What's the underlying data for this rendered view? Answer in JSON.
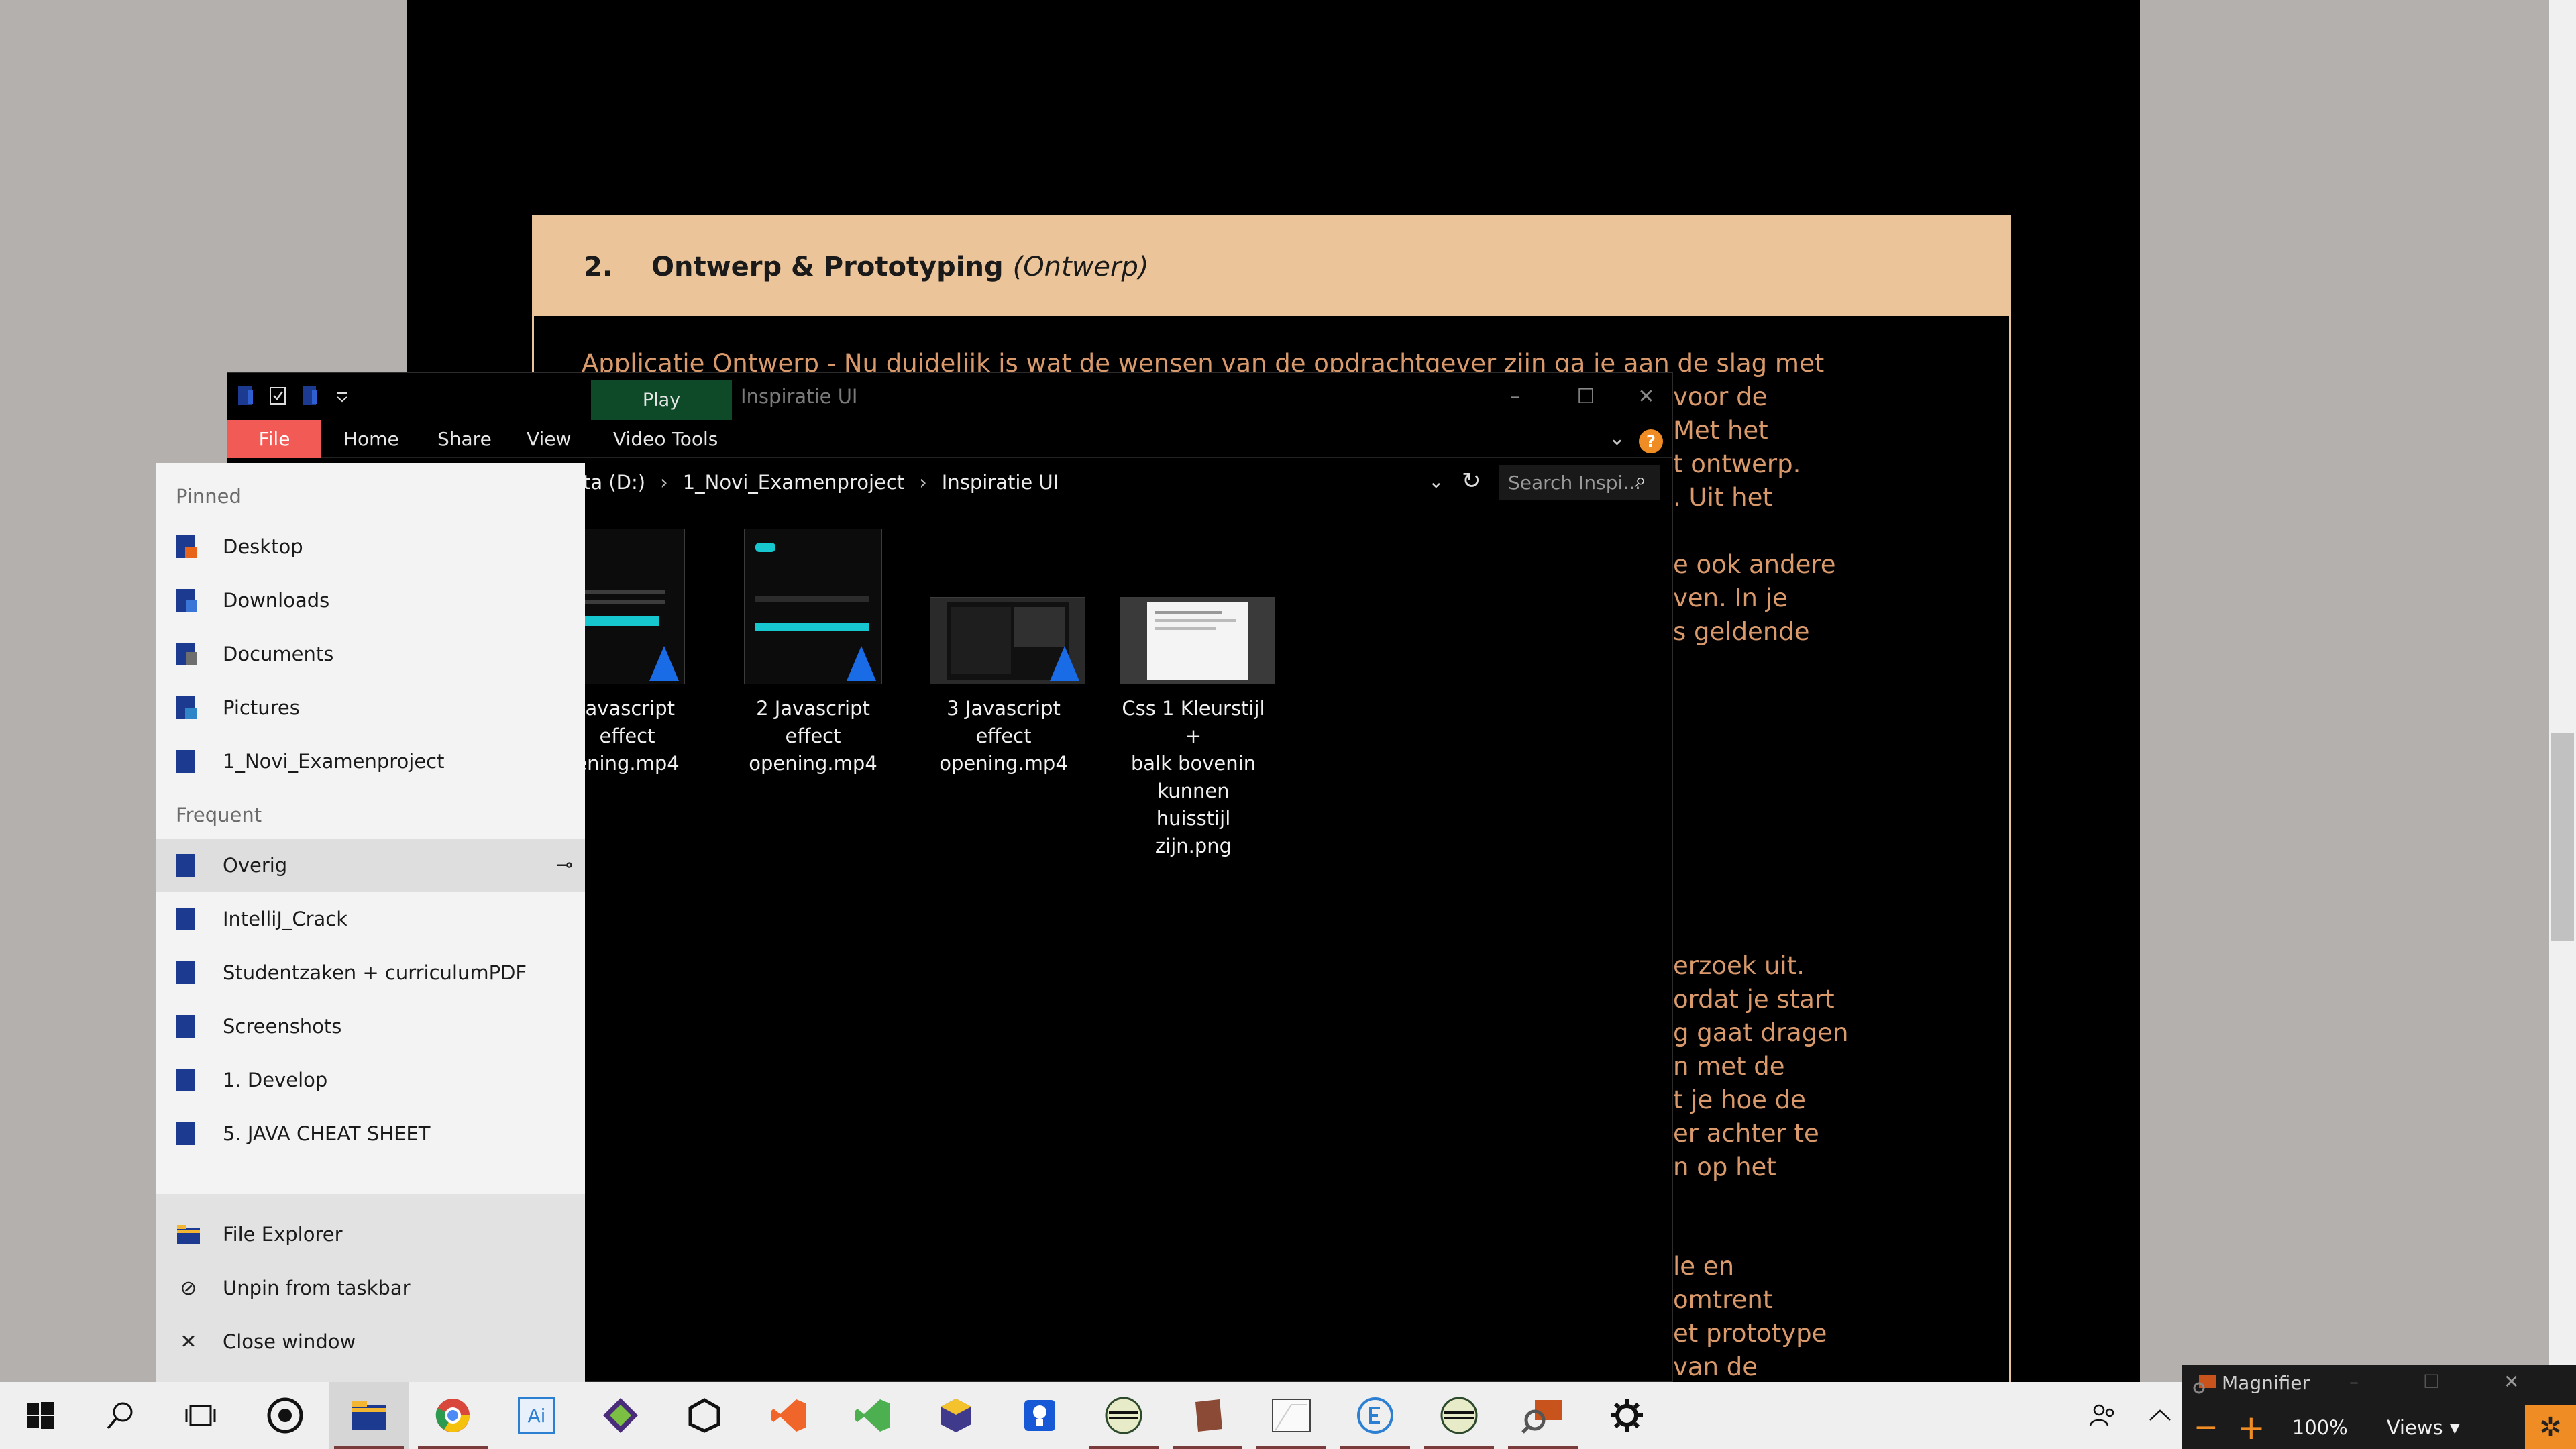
{
  "document": {
    "section_number": "2.",
    "section_title": "Ontwerp & Prototyping",
    "section_subtitle": "(Ontwerp)",
    "lines_top": [
      "Applicatie Ontwerp - Nu duidelijk is wat de wensen van de opdrachtgever zijn ga je aan de slag met",
      "voor de",
      "Met het",
      "t ontwerp.",
      ". Uit het"
    ],
    "lines_mid": [
      "e ook andere",
      "ven. In je",
      "s geldende"
    ],
    "lines_low": [
      "erzoek uit.",
      "ordat je start",
      "g gaat dragen",
      "n met de",
      "t je hoe de",
      "er achter te",
      "n op het"
    ],
    "lines_bottom": [
      "le en",
      "omtrent",
      "et prototype",
      "van de"
    ]
  },
  "explorer": {
    "title": "Inspiratie UI",
    "contextual_tab": "Play",
    "ribbon_tabs": {
      "file": "File",
      "home": "Home",
      "share": "Share",
      "view": "View",
      "video_tools": "Video Tools"
    },
    "help_label": "?",
    "address": {
      "part1": "ta (D:)",
      "part2": "1_Novi_Examenproject",
      "part3": "Inspiratie UI"
    },
    "search_placeholder": "Search Inspi...",
    "files": [
      {
        "name": "Javascript\neffect\nening.mp4"
      },
      {
        "name": "2 Javascript\neffect\nopening.mp4"
      },
      {
        "name": "3 Javascript\neffect\nopening.mp4"
      },
      {
        "name": "Css 1 Kleurstijl +\nbalk bovenin\nkunnen huisstijl\nzijn.png"
      }
    ]
  },
  "jumplist": {
    "pinned_header": "Pinned",
    "pinned": [
      "Desktop",
      "Downloads",
      "Documents",
      "Pictures",
      "1_Novi_Examenproject"
    ],
    "frequent_header": "Frequent",
    "frequent": [
      "Overig",
      "IntelliJ_Crack",
      "Studentzaken + curriculumPDF",
      "Screenshots",
      "1. Develop",
      "5. JAVA CHEAT SHEET"
    ],
    "actions": {
      "explorer": "File Explorer",
      "unpin": "Unpin from taskbar",
      "close": "Close window"
    }
  },
  "taskbar": {
    "illustrator_label": "Ai"
  },
  "magnifier": {
    "title": "Magnifier",
    "zoom": "100%",
    "views": "Views"
  },
  "colors": {
    "accent": "#f25a55",
    "doc_header": "#ecc499",
    "doc_text": "#d9996a",
    "play_tab": "#0e4a28"
  }
}
